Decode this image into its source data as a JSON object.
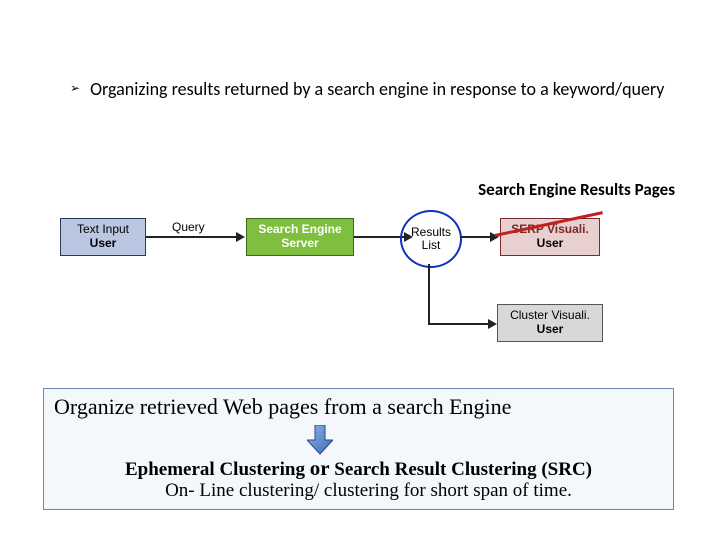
{
  "bullet": {
    "marker": "➢",
    "text": "Organizing results returned by a search engine in response to a keyword/query"
  },
  "serp_label": "Search Engine Results Pages",
  "diagram": {
    "text_input": {
      "line1": "Text Input",
      "line2": "User"
    },
    "query_label": "Query",
    "server": {
      "line1": "Search Engine",
      "line2": "Server"
    },
    "results": {
      "line1": "Results",
      "line2": "List"
    },
    "serp_box": {
      "line1": "SERP Visuali.",
      "line2": "User"
    },
    "cluster_box": {
      "line1": "Cluster Visuali.",
      "line2": "User"
    }
  },
  "bottom": {
    "organize": "Organize retrieved  Web pages from a search Engine",
    "ephemeral_a": "Ephemeral Clustering",
    "or": "or",
    "ephemeral_b": "Search Result Clustering (SRC)",
    "online": "On- Line clustering/ clustering for short span of time."
  }
}
